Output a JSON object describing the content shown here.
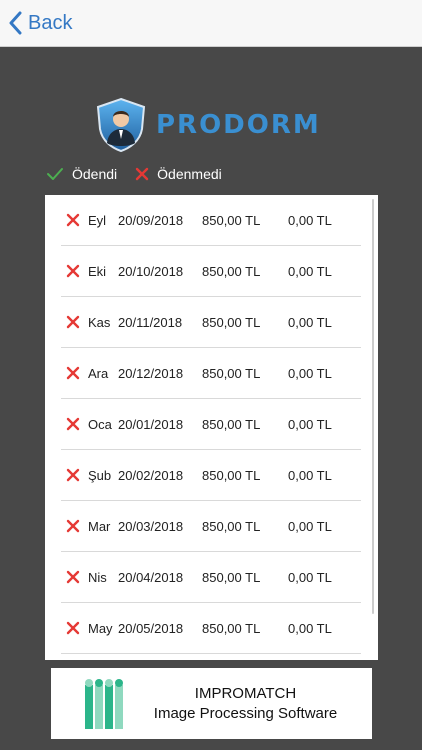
{
  "nav": {
    "back_label": "Back"
  },
  "brand": {
    "name": "PRODORM"
  },
  "legend": {
    "paid": "Ödendi",
    "unpaid": "Ödenmedi"
  },
  "colors": {
    "accent": "#3478c4",
    "paid": "#4caf50",
    "unpaid": "#e53935",
    "background": "#484848"
  },
  "payments": [
    {
      "month": "Eyl",
      "date": "20/09/2018",
      "amount": "850,00 TL",
      "paid_amount": "0,00 TL",
      "status": "unpaid"
    },
    {
      "month": "Eki",
      "date": "20/10/2018",
      "amount": "850,00 TL",
      "paid_amount": "0,00 TL",
      "status": "unpaid"
    },
    {
      "month": "Kas",
      "date": "20/11/2018",
      "amount": "850,00 TL",
      "paid_amount": "0,00 TL",
      "status": "unpaid"
    },
    {
      "month": "Ara",
      "date": "20/12/2018",
      "amount": "850,00 TL",
      "paid_amount": "0,00 TL",
      "status": "unpaid"
    },
    {
      "month": "Oca",
      "date": "20/01/2018",
      "amount": "850,00 TL",
      "paid_amount": "0,00 TL",
      "status": "unpaid"
    },
    {
      "month": "Şub",
      "date": "20/02/2018",
      "amount": "850,00 TL",
      "paid_amount": "0,00 TL",
      "status": "unpaid"
    },
    {
      "month": "Mar",
      "date": "20/03/2018",
      "amount": "850,00 TL",
      "paid_amount": "0,00 TL",
      "status": "unpaid"
    },
    {
      "month": "Nis",
      "date": "20/04/2018",
      "amount": "850,00 TL",
      "paid_amount": "0,00 TL",
      "status": "unpaid"
    },
    {
      "month": "May",
      "date": "20/05/2018",
      "amount": "850,00 TL",
      "paid_amount": "0,00 TL",
      "status": "unpaid"
    }
  ],
  "footer": {
    "company": "IMPROMATCH",
    "tagline": "Image Processing Software"
  }
}
